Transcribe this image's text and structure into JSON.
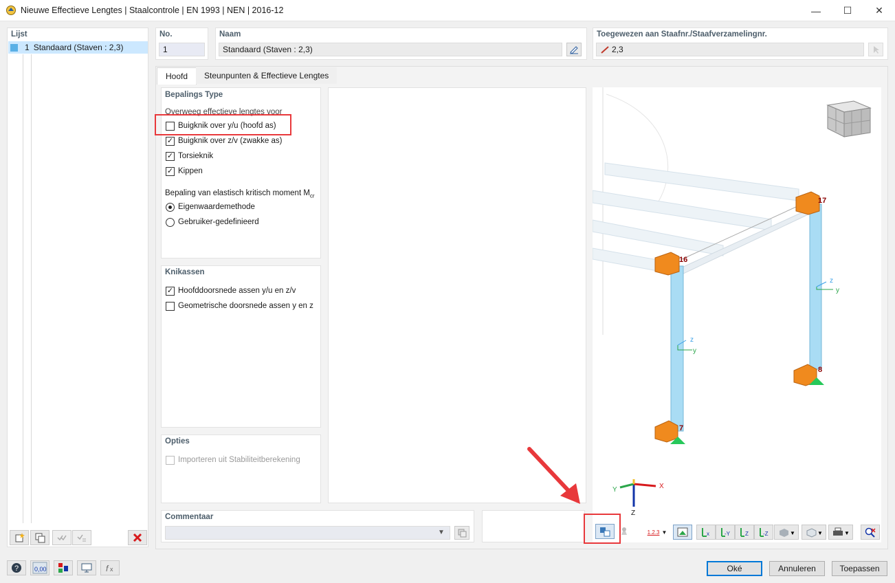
{
  "window": {
    "title": "Nieuwe Effectieve Lengtes | Staalcontrole | EN 1993 | NEN | 2016-12",
    "minimize": "—",
    "maximize": "☐",
    "close": "✕"
  },
  "list": {
    "header": "Lijst",
    "items": [
      {
        "number": "1",
        "label": "Standaard (Staven : 2,3)"
      }
    ]
  },
  "fields": {
    "no_label": "No.",
    "no_value": "1",
    "name_label": "Naam",
    "name_value": "Standaard (Staven : 2,3)",
    "assigned_label": "Toegewezen aan Staafnr./Staafverzamelingnr.",
    "assigned_value": "2,3"
  },
  "tabs": [
    {
      "label": "Hoofd",
      "active": true
    },
    {
      "label": "Steunpunten & Effectieve Lengtes",
      "active": false
    }
  ],
  "determination": {
    "header": "Bepalings Type",
    "sub_header": "Overweeg effectieve lengtes voor",
    "options": [
      {
        "label": "Buigknik over y/u (hoofd as)",
        "checked": false
      },
      {
        "label": "Buigknik over z/v (zwakke as)",
        "checked": true
      },
      {
        "label": "Torsieknik",
        "checked": true
      },
      {
        "label": "Kippen",
        "checked": true
      }
    ],
    "mcr_header": "Bepaling van elastisch kritisch moment M",
    "mcr_sub": "cr",
    "mcr_options": [
      {
        "label": "Eigenwaardemethode",
        "selected": true
      },
      {
        "label": "Gebruiker-gedefinieerd",
        "selected": false
      }
    ]
  },
  "buckling_axes": {
    "header": "Knikassen",
    "options": [
      {
        "label": "Hoofddoorsnede assen y/u en z/v",
        "checked": true
      },
      {
        "label": "Geometrische doorsnede assen y en z",
        "checked": false
      }
    ]
  },
  "options_box": {
    "header": "Opties",
    "options": [
      {
        "label": "Importeren uit Stabiliteitberekening",
        "checked": false,
        "disabled": true
      }
    ]
  },
  "comment": {
    "header": "Commentaar",
    "value": ""
  },
  "view3d": {
    "node_labels": [
      "17",
      "16",
      "8",
      "7"
    ],
    "axis_labels": {
      "x": "X",
      "y": "Y",
      "z": "Z"
    },
    "local_axis": {
      "y": "y",
      "z": "z"
    },
    "toolbar_numbering": "1.2.3"
  },
  "buttons": {
    "ok": "Oké",
    "cancel": "Annuleren",
    "apply": "Toepassen"
  },
  "colors": {
    "accent": "#0078d7",
    "highlight": "#e8383b",
    "member": "#a9dcf4",
    "support": "#f08a1e",
    "selection": "#cce8ff"
  }
}
